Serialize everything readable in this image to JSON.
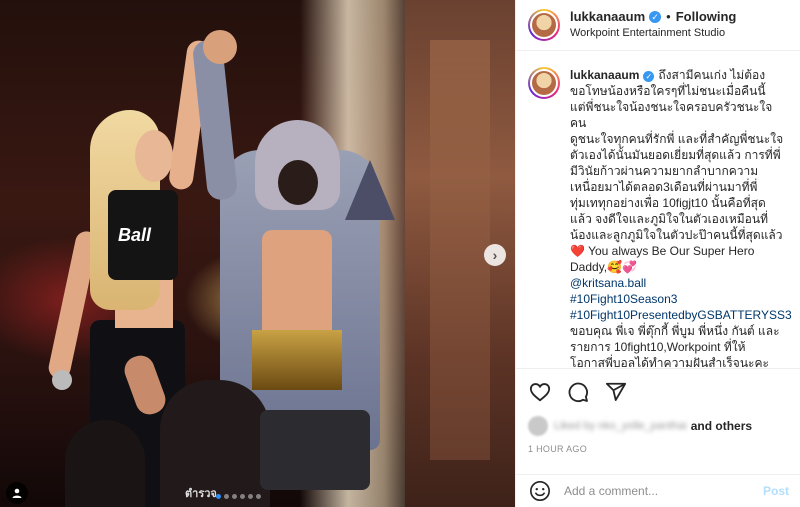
{
  "post": {
    "username": "lukkanaaum",
    "separator": "•",
    "follow_status": "Following",
    "location": "Workpoint Entertainment Studio",
    "photo_overlay_text": "ตำรวจ",
    "shirt_text": "Ball",
    "carousel": {
      "count": 6,
      "active_index": 0
    }
  },
  "caption": {
    "username": "lukkanaaum",
    "lines": [
      "ถึงสามีคนเก่ง ไม่ต้อง",
      "ขอโทษน้องหรือใครๆที่ไม่ชนะเมื่อคืนนี้",
      "แต่พี่ชนะใจน้องชนะใจครอบครัวชนะใจคน",
      "ดูชนะใจทุกคนที่รักพี่ และที่สำคัญพี่ชนะใจ",
      "ตัวเองได้นั้นมันยอดเยี่ยมที่สุดแล้ว การที่พี่",
      "มีวินัยก้าวผ่านความยากลำบากความ",
      "เหนื่อยมาได้ตลอด3เดือนที่ผ่านมาที่พี่",
      "ทุ่มเททุกอย่างเพื่อ 10figjt10 นั้นคือที่สุด",
      "แล้ว จงดีใจและภูมิใจในตัวเองเหมือนที่",
      "น้องและลูกภูมิใจในตัวปะป๊าคนนี้ที่สุดแล้ว"
    ],
    "heart_line_emoji": "❤️",
    "heart_line_text": " You always Be Our Super Hero",
    "daddy_text": "Daddy,",
    "daddy_emojis": "🥰💞",
    "mention": "@kritsana.ball",
    "hashtags": [
      "#10Fight10Season3",
      "#10Fight10PresentedbyGSBATTERYSS3"
    ],
    "thanks_lines": [
      "ขอบคุณ พี่เจ พี่ตุ๊กกี้ พี่บูม พี่หนึ่ง กันต์ และ",
      "รายการ 10fight10,Workpoint ที่ให้",
      "โอกาสพี่บอลได้ทำความฝันสำเร็จนะคะ"
    ]
  },
  "likes": {
    "liked_by_blurred": "Liked by nko_yolle_panthai",
    "and_others": "and others"
  },
  "timestamp": "1 HOUR AGO",
  "comment": {
    "placeholder": "Add a comment...",
    "post_label": "Post"
  },
  "colors": {
    "verified": "#3897f0",
    "link": "#00376b",
    "post_disabled": "#b2dffc",
    "carousel_active_dot": "#2d8cf0"
  },
  "icons": {
    "like": "heart-icon",
    "comment": "comment-icon",
    "share": "share-icon",
    "emoji": "emoji-icon",
    "next": "chevron-right-icon",
    "tags": "user-tag-icon"
  }
}
